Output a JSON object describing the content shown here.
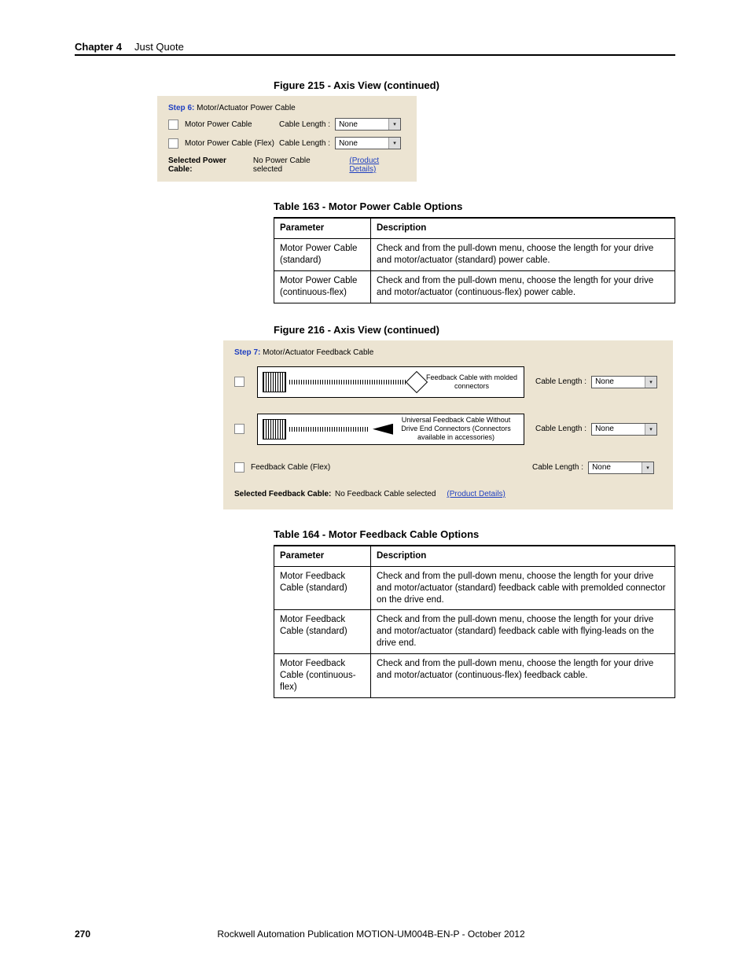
{
  "header": {
    "chapter": "Chapter 4",
    "title": "Just Quote"
  },
  "fig215": {
    "title": "Figure 215 - Axis View (continued)",
    "step_prefix": "Step 6:",
    "step_title": "Motor/Actuator Power Cable",
    "rows": [
      {
        "label": "Motor Power Cable",
        "len_label": "Cable Length :",
        "value": "None"
      },
      {
        "label": "Motor Power Cable (Flex)",
        "len_label": "Cable Length :",
        "value": "None"
      }
    ],
    "selected_label": "Selected Power Cable:",
    "selected_value": "No Power Cable selected",
    "details_link": "(Product Details)"
  },
  "tbl163": {
    "title": "Table 163 - Motor Power Cable Options",
    "headers": {
      "param": "Parameter",
      "desc": "Description"
    },
    "rows": [
      {
        "param": "Motor Power Cable (standard)",
        "desc": "Check and from the pull-down menu, choose the length for your drive and motor/actuator (standard) power cable."
      },
      {
        "param": "Motor Power Cable (continuous-flex)",
        "desc": "Check and from the pull-down menu, choose the length for your drive and motor/actuator (continuous-flex) power cable."
      }
    ]
  },
  "fig216": {
    "title": "Figure 216 - Axis View (continued)",
    "step_prefix": "Step 7:",
    "step_title": "Motor/Actuator Feedback Cable",
    "rows": [
      {
        "diag_text": "Feedback Cable with molded connectors",
        "len_label": "Cable Length :",
        "value": "None"
      },
      {
        "diag_text": "Universal Feedback Cable Without Drive End Connectors (Connectors available in accessories)",
        "len_label": "Cable Length :",
        "value": "None"
      },
      {
        "plain_label": "Feedback Cable (Flex)",
        "len_label": "Cable Length :",
        "value": "None"
      }
    ],
    "selected_label": "Selected Feedback Cable:",
    "selected_value": "No Feedback Cable selected",
    "details_link": "(Product Details)"
  },
  "tbl164": {
    "title": "Table 164 - Motor Feedback Cable Options",
    "headers": {
      "param": "Parameter",
      "desc": "Description"
    },
    "rows": [
      {
        "param": "Motor Feedback Cable (standard)",
        "desc": "Check and from the pull-down menu, choose the length for your drive and motor/actuator (standard) feedback cable with premolded connector on the drive end."
      },
      {
        "param": "Motor Feedback Cable (standard)",
        "desc": "Check and from the pull-down menu, choose the length for your drive and motor/actuator (standard) feedback cable with flying-leads on the drive end."
      },
      {
        "param": "Motor Feedback Cable (continuous-flex)",
        "desc": "Check and from the pull-down menu, choose the length for your drive and motor/actuator (continuous-flex) feedback cable."
      }
    ]
  },
  "footer": {
    "page": "270",
    "pub": "Rockwell Automation Publication MOTION-UM004B-EN-P - October 2012"
  }
}
